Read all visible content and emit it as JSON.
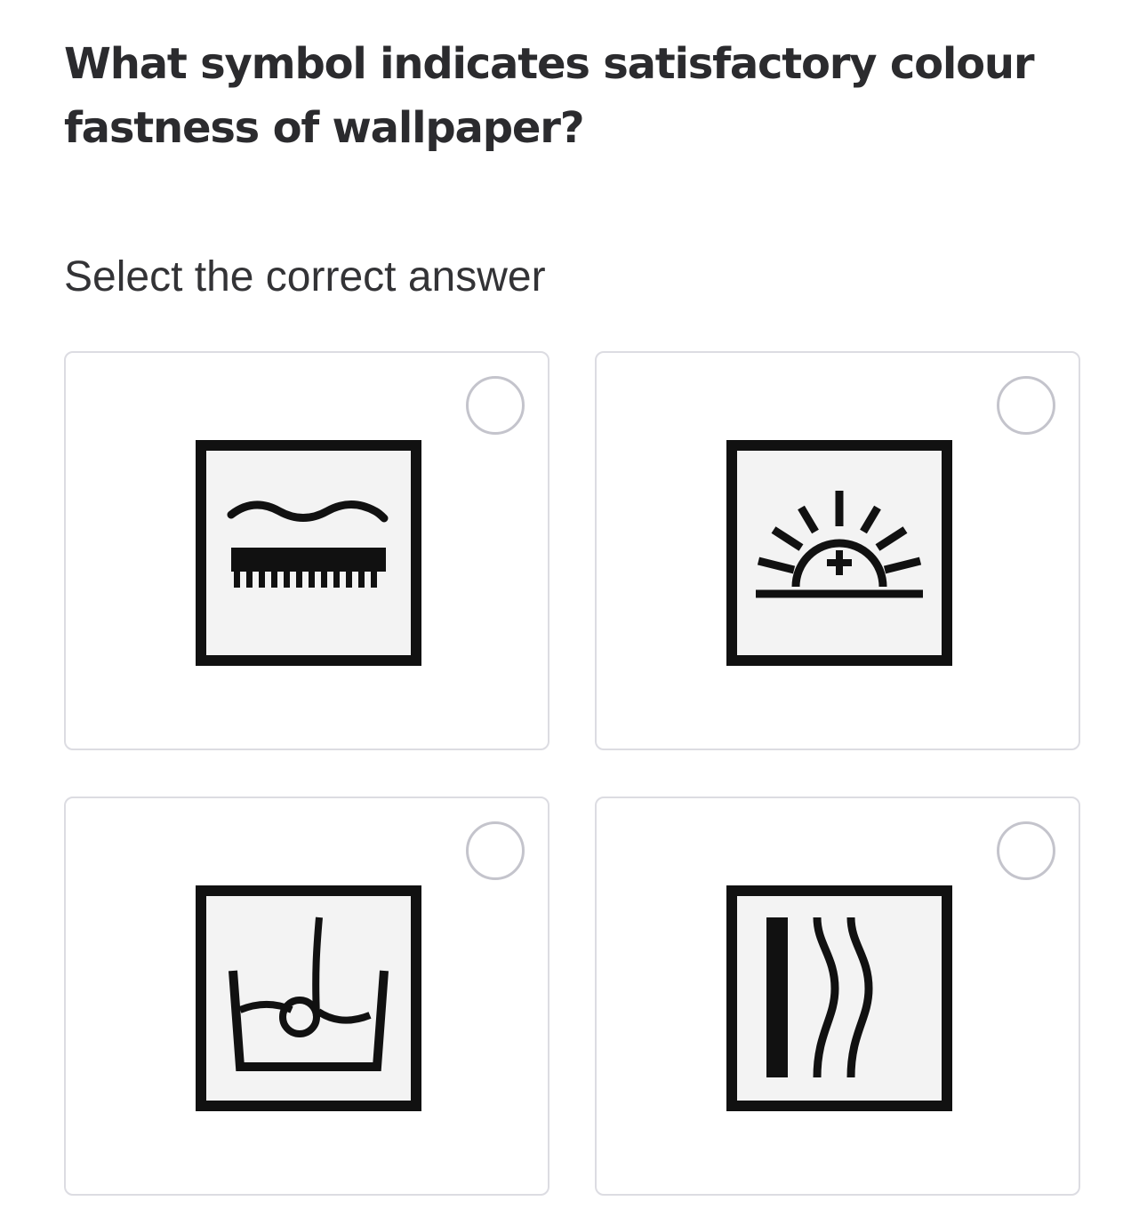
{
  "question": {
    "text": "What symbol indicates satisfactory colour fastness of wallpaper?"
  },
  "instruction": {
    "text": "Select the correct answer"
  },
  "options": [
    {
      "icon": "scrubbable-brush-icon",
      "selected": false
    },
    {
      "icon": "light-fastness-sun-icon",
      "selected": false
    },
    {
      "icon": "paste-the-paper-icon",
      "selected": false
    },
    {
      "icon": "straight-match-icon",
      "selected": false
    }
  ],
  "colors": {
    "border": "#dcdce2",
    "radio_border": "#c4c4cc",
    "text": "#2b2b2e",
    "symbol_fill": "#f3f3f3",
    "symbol_stroke": "#111111"
  }
}
